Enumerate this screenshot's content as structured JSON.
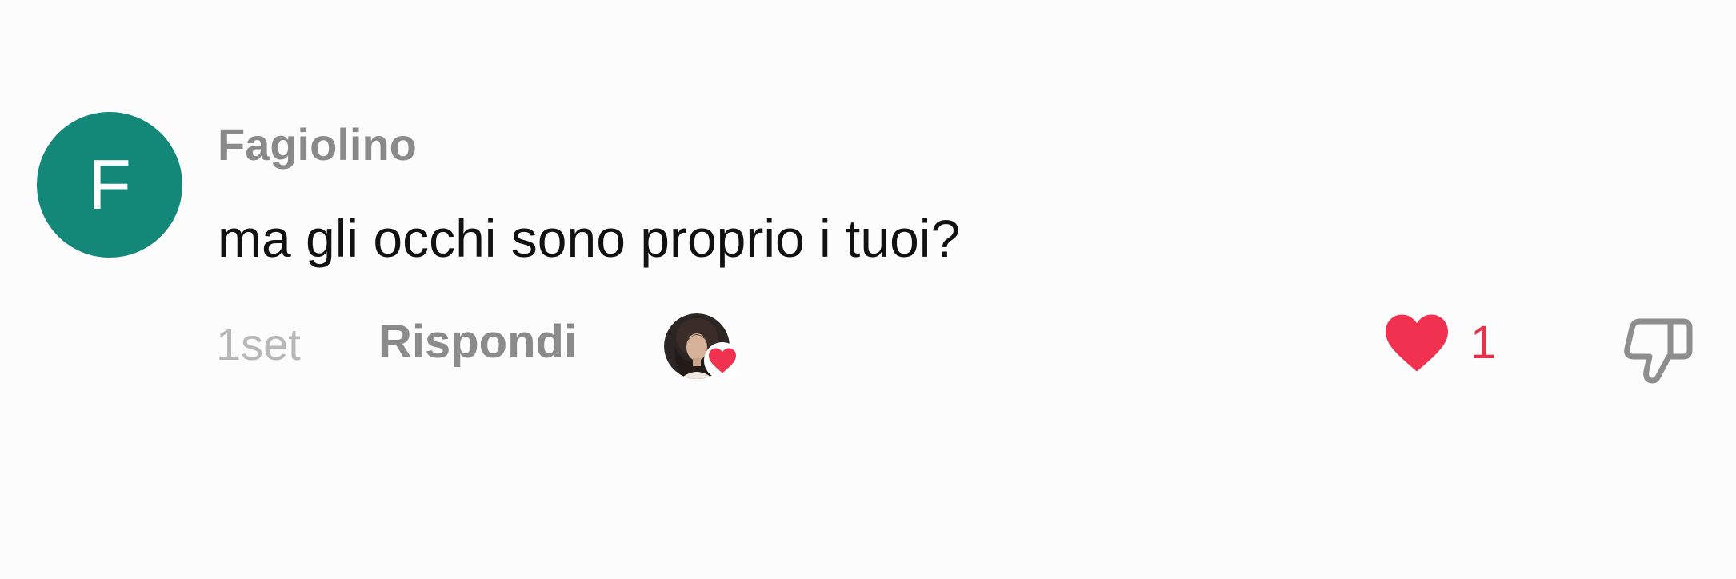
{
  "comment": {
    "avatar_letter": "F",
    "avatar_color": "#138879",
    "username": "Fagiolino",
    "text": "ma gli occhi sono proprio i tuoi?",
    "time": "1set",
    "reply_label": "Rispondi",
    "creator_liked": true,
    "likes": {
      "count": "1",
      "liked": true,
      "color": "#e8334f",
      "icon": "heart-icon"
    },
    "dislike_icon": "thumbs-down-icon"
  }
}
